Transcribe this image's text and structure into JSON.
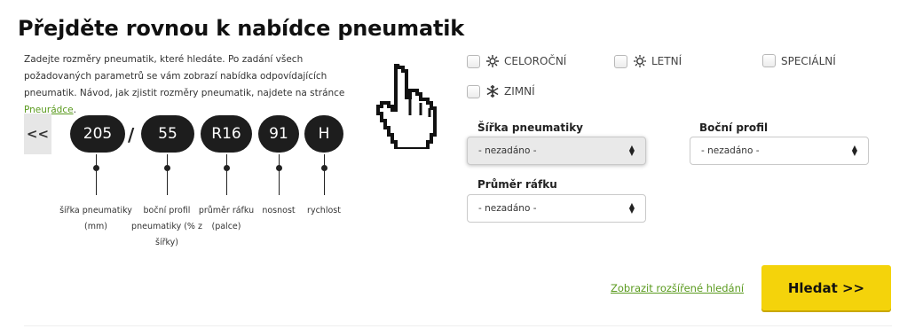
{
  "title": "Přejděte rovnou k nabídce pneumatik",
  "intro": {
    "text": "Zadejte rozměry pneumatik, které hledáte. Po zadání všech požadovaných parametrů se vám zobrazí nabídka odpovídajících pneumatik. Návod, jak zjistit rozměry pneumatik, najdete na stránce ",
    "link": "Pneurádce",
    "after": "."
  },
  "back_button": "<<",
  "tire_code": {
    "width": "205",
    "separator": "/",
    "profile": "55",
    "rim": "R16",
    "load": "91",
    "speed": "H"
  },
  "captions": {
    "width": "šířka pneumatiky (mm)",
    "profile": "boční profil pneumatiky (% z šířky)",
    "rim": "průměr ráfku (palce)",
    "load": "nosnost",
    "speed": "rychlost"
  },
  "seasons": [
    {
      "label": "CELOROČNÍ",
      "icon": "sun-snowflake-icon",
      "checked": false
    },
    {
      "label": "LETNÍ",
      "icon": "sun-icon",
      "checked": false
    },
    {
      "label": "SPECIÁLNÍ",
      "icon": "",
      "checked": false
    },
    {
      "label": "ZIMNÍ",
      "icon": "snowflake-icon",
      "checked": false
    }
  ],
  "fields": {
    "width": {
      "label": "Šířka pneumatiky",
      "value": "- nezadáno -"
    },
    "profile": {
      "label": "Boční profil",
      "value": "- nezadáno -"
    },
    "rim": {
      "label": "Průměr ráfku",
      "value": "- nezadáno -"
    }
  },
  "advanced_link": "Zobrazit rozšířené hledání",
  "search_button": "Hledat >>",
  "colors": {
    "accent": "#f4d30b",
    "link": "#5a9a1e",
    "pill": "#1d1d1d"
  }
}
